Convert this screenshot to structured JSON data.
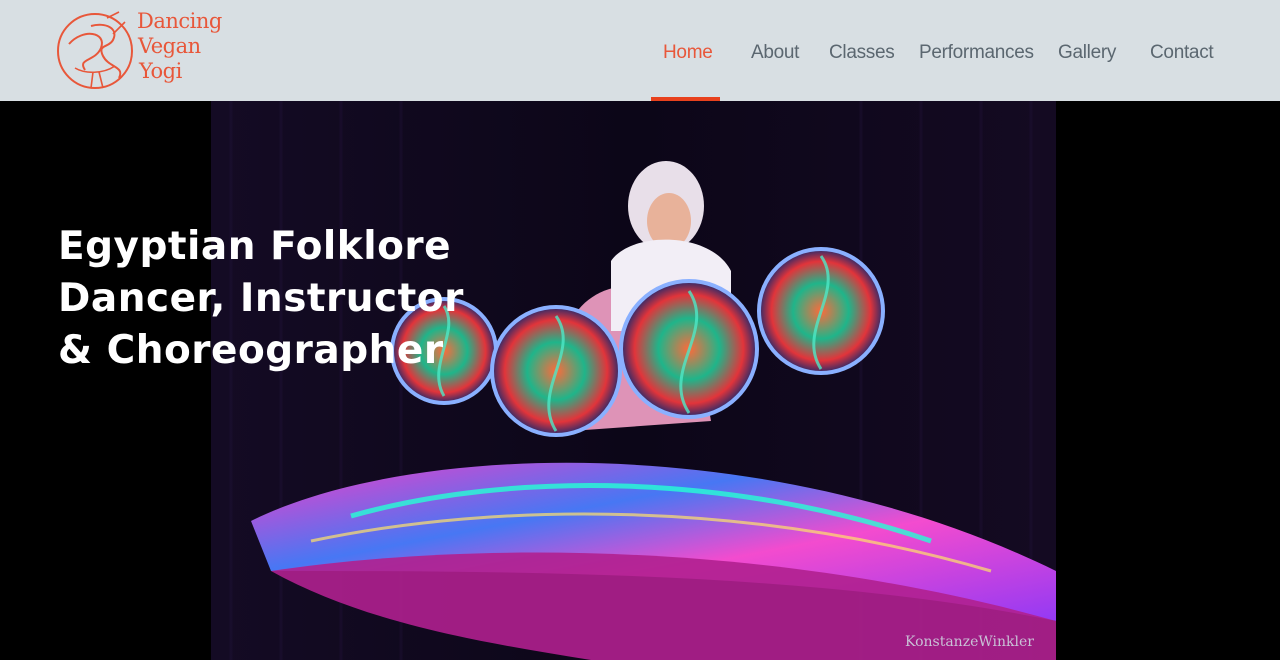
{
  "header": {
    "logo": {
      "line1": "Dancing",
      "line2": "Vegan",
      "line3": "Yogi"
    },
    "nav": [
      {
        "label": "Home",
        "active": true
      },
      {
        "label": "About",
        "active": false
      },
      {
        "label": "Classes",
        "active": false
      },
      {
        "label": "Performances",
        "active": false
      },
      {
        "label": "Gallery",
        "active": false
      },
      {
        "label": "Contact",
        "active": false
      }
    ]
  },
  "hero": {
    "headline": "Egyptian Folklore Dancer, Instructor & Choreographer",
    "photo_credit": "KonstanzeWinkler"
  },
  "colors": {
    "accent": "#e8573a",
    "active_underline": "#e8411d",
    "header_bg": "#d8dfe3",
    "nav_text": "#5b6770",
    "hero_bg": "#000000"
  }
}
